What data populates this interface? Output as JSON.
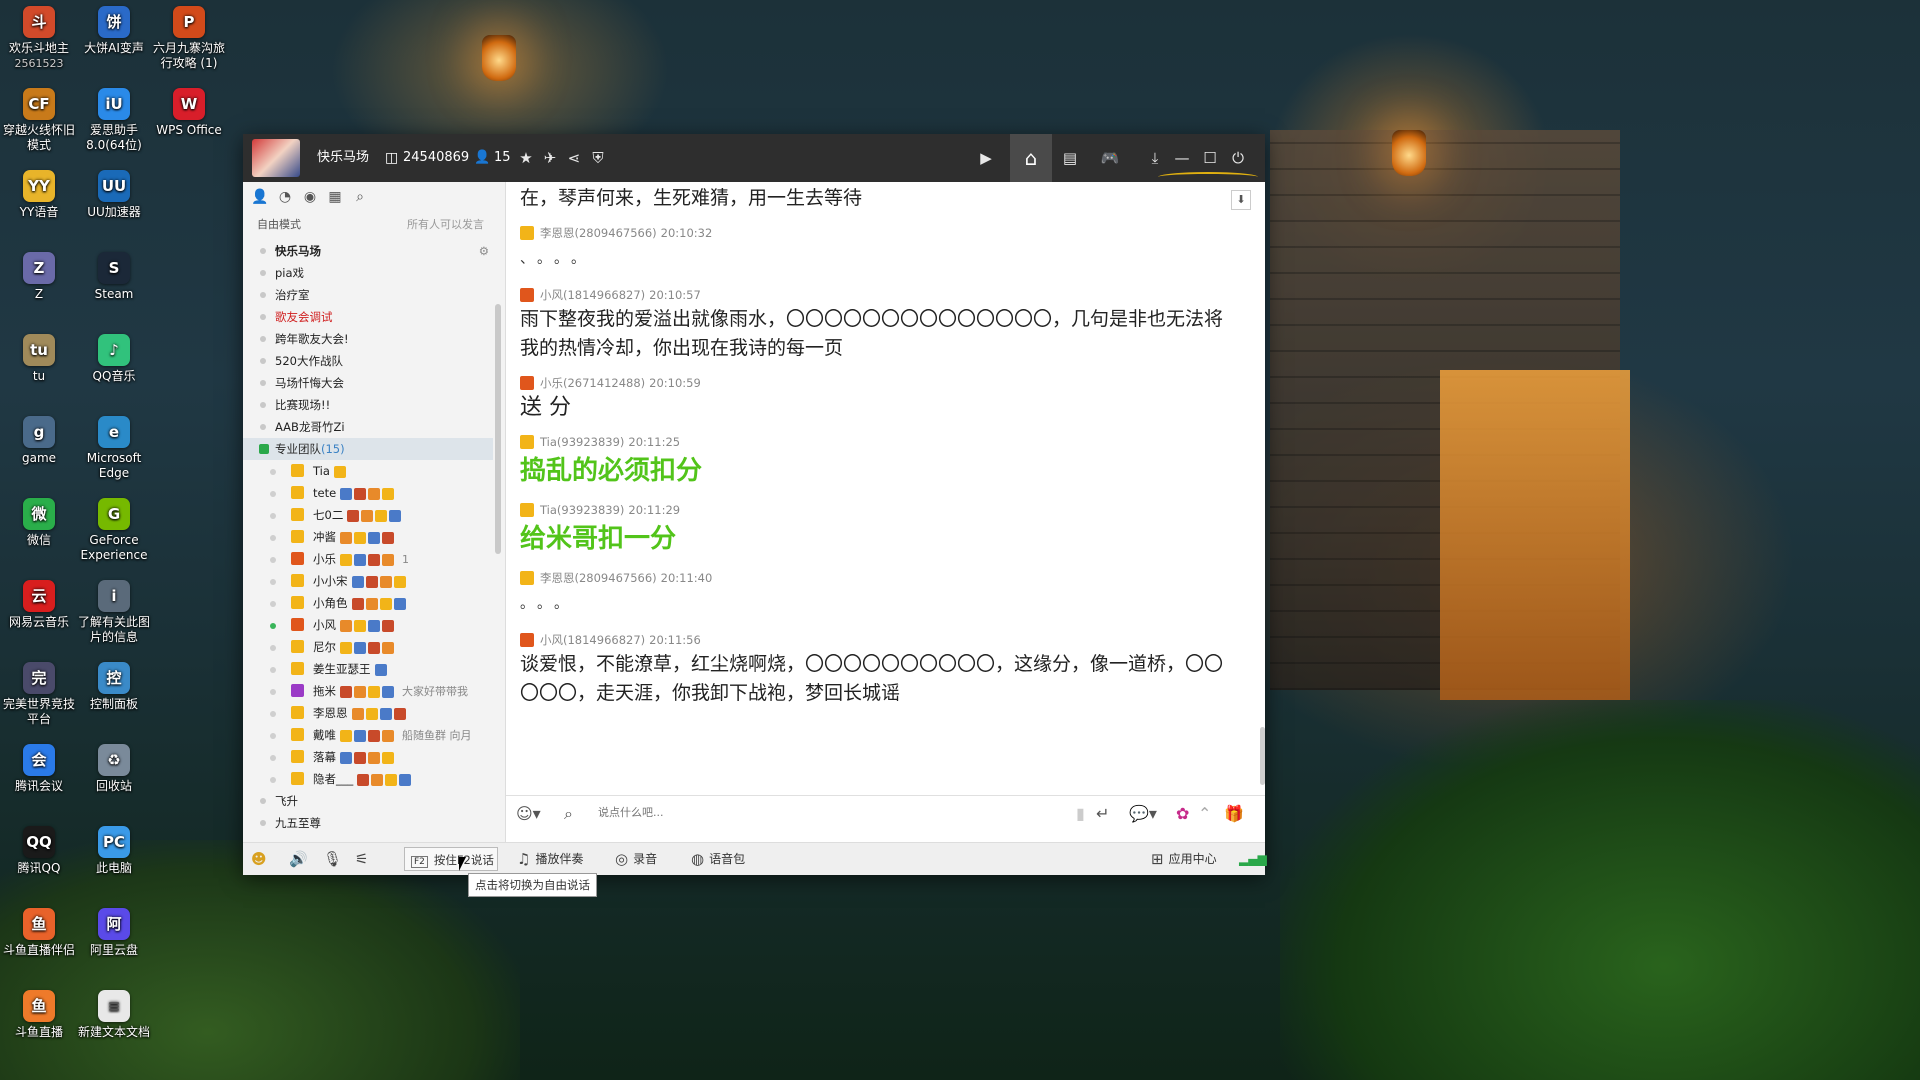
{
  "desktop": {
    "col1": [
      {
        "label": "欢乐斗地主",
        "sub": "2561523",
        "glyph": "斗",
        "color": "#d24a2a"
      },
      {
        "label": "穿越火线怀旧模式",
        "sub": "",
        "glyph": "CF",
        "color": "#c87a1a"
      },
      {
        "label": "YY语音",
        "sub": "",
        "glyph": "YY",
        "color": "#e8b42a"
      },
      {
        "label": "Z",
        "sub": "",
        "glyph": "Z",
        "color": "#6a6aa8"
      },
      {
        "label": "tu",
        "sub": "",
        "glyph": "tu",
        "color": "#a08a5a"
      },
      {
        "label": "game",
        "sub": "",
        "glyph": "g",
        "color": "#4a6a8a"
      },
      {
        "label": "微信",
        "sub": "",
        "glyph": "微",
        "color": "#2aae4a"
      },
      {
        "label": "网易云音乐",
        "sub": "",
        "glyph": "云",
        "color": "#d81e1e"
      },
      {
        "label": "完美世界竞技平台",
        "sub": "",
        "glyph": "完",
        "color": "#4a4a6a"
      },
      {
        "label": "腾讯会议",
        "sub": "",
        "glyph": "会",
        "color": "#2a7ae8"
      },
      {
        "label": "腾讯QQ",
        "sub": "",
        "glyph": "QQ",
        "color": "#1a1a1a"
      },
      {
        "label": "斗鱼直播伴侣",
        "sub": "",
        "glyph": "鱼",
        "color": "#e8622a"
      },
      {
        "label": "斗鱼直播",
        "sub": "",
        "glyph": "鱼",
        "color": "#ee7a2a"
      }
    ],
    "col2": [
      {
        "label": "大饼AI变声",
        "sub": "",
        "glyph": "饼",
        "color": "#2a6ac8"
      },
      {
        "label": "爱思助手8.0(64位)",
        "sub": "",
        "glyph": "iU",
        "color": "#2a8ae8"
      },
      {
        "label": "UU加速器",
        "sub": "",
        "glyph": "UU",
        "color": "#1a6ab8"
      },
      {
        "label": "Steam",
        "sub": "",
        "glyph": "S",
        "color": "#1b2838"
      },
      {
        "label": "QQ音乐",
        "sub": "",
        "glyph": "♪",
        "color": "#31c27c"
      },
      {
        "label": "Microsoft Edge",
        "sub": "",
        "glyph": "e",
        "color": "#2a8ac8"
      },
      {
        "label": "GeForce Experience",
        "sub": "",
        "glyph": "G",
        "color": "#76b900"
      },
      {
        "label": "了解有关此图片的信息",
        "sub": "",
        "glyph": "i",
        "color": "#5a6a7a"
      },
      {
        "label": "控制面板",
        "sub": "",
        "glyph": "控",
        "color": "#3a8ac8"
      },
      {
        "label": "回收站",
        "sub": "",
        "glyph": "♻",
        "color": "#7a8a9a"
      },
      {
        "label": "此电脑",
        "sub": "",
        "glyph": "PC",
        "color": "#3a9ae8"
      },
      {
        "label": "阿里云盘",
        "sub": "",
        "glyph": "阿",
        "color": "#5a4ae8"
      },
      {
        "label": "新建文本文档",
        "sub": "",
        "glyph": "≡",
        "color": "#e8e8e8"
      }
    ],
    "col3": [
      {
        "label": "六月九寨沟旅行攻略 (1)",
        "sub": "",
        "glyph": "P",
        "color": "#d24a1a"
      },
      {
        "label": "WPS Office",
        "sub": "",
        "glyph": "W",
        "color": "#d81e2a"
      }
    ]
  },
  "window": {
    "channel_name": "快乐马场",
    "channel_id": "24540869",
    "online_count": "15",
    "mode_label": "自由模式",
    "mode_hint": "所有人可以发言"
  },
  "tree": {
    "root": "快乐马场",
    "channels": [
      {
        "label": "pia戏",
        "style": ""
      },
      {
        "label": "治疗室",
        "style": ""
      },
      {
        "label": "歌友会调试",
        "style": "red"
      },
      {
        "label": "跨年歌友大会!",
        "style": ""
      },
      {
        "label": "520大作战队",
        "style": ""
      },
      {
        "label": "马场忏悔大会",
        "style": ""
      },
      {
        "label": "比赛现场!!",
        "style": ""
      },
      {
        "label": "AAB龙哥竹Zi",
        "style": ""
      }
    ],
    "group": {
      "label": "专业团队",
      "count": "(15)"
    },
    "members": [
      {
        "name": "Tia",
        "role": "",
        "online": false,
        "note": ""
      },
      {
        "name": "tete",
        "role": "",
        "online": false,
        "note": ""
      },
      {
        "name": "七0二",
        "role": "",
        "online": false,
        "note": ""
      },
      {
        "name": "冲酱",
        "role": "",
        "online": false,
        "note": ""
      },
      {
        "name": "小乐",
        "role": "red",
        "online": false,
        "note": "1"
      },
      {
        "name": "小小宋",
        "role": "",
        "online": false,
        "note": ""
      },
      {
        "name": "小角色",
        "role": "",
        "online": false,
        "note": ""
      },
      {
        "name": "小风",
        "role": "red",
        "online": true,
        "note": ""
      },
      {
        "name": "尼尔",
        "role": "",
        "online": false,
        "note": ""
      },
      {
        "name": "姜生亚瑟王",
        "role": "",
        "online": false,
        "note": ""
      },
      {
        "name": "拖米",
        "role": "purple",
        "online": false,
        "note": "大家好带带我"
      },
      {
        "name": "李恩恩",
        "role": "",
        "online": false,
        "note": ""
      },
      {
        "name": "戴唯",
        "role": "",
        "online": false,
        "note": "船随鱼群 向月"
      },
      {
        "name": "落幕",
        "role": "",
        "online": false,
        "note": ""
      },
      {
        "name": "隐者___",
        "role": "",
        "online": false,
        "note": ""
      }
    ],
    "after": [
      {
        "label": "飞升"
      },
      {
        "label": "九五至尊"
      }
    ]
  },
  "messages": [
    {
      "type": "text",
      "text": "在，琴声何来，生死难猜，用一生去等待",
      "meta": false
    },
    {
      "type": "meta",
      "sender": "李恩恩(2809467566)",
      "time": "20:10:32",
      "icon": ""
    },
    {
      "type": "dots",
      "text": "、。。。"
    },
    {
      "type": "meta",
      "sender": "小风(1814966827)",
      "time": "20:10:57",
      "icon": "red"
    },
    {
      "type": "text",
      "text": "雨下整夜我的爱溢出就像雨水，〇〇〇〇〇〇〇〇〇〇〇〇〇〇，几句是非也无法将我的热情冷却，你出现在我诗的每一页"
    },
    {
      "type": "meta",
      "sender": "小乐(2671412488)",
      "time": "20:10:59",
      "icon": "red"
    },
    {
      "type": "big",
      "text": "送 分"
    },
    {
      "type": "meta",
      "sender": "Tia(93923839)",
      "time": "20:11:25",
      "icon": ""
    },
    {
      "type": "green",
      "text": "捣乱的必须扣分"
    },
    {
      "type": "meta",
      "sender": "Tia(93923839)",
      "time": "20:11:29",
      "icon": ""
    },
    {
      "type": "green",
      "text": "给米哥扣一分"
    },
    {
      "type": "meta",
      "sender": "李恩恩(2809467566)",
      "time": "20:11:40",
      "icon": ""
    },
    {
      "type": "dots",
      "text": "。。。"
    },
    {
      "type": "meta",
      "sender": "小风(1814966827)",
      "time": "20:11:56",
      "icon": "red"
    },
    {
      "type": "text",
      "text": "谈爱恨，不能潦草，红尘烧啊烧，〇〇〇〇〇〇〇〇〇〇，这缘分，像一道桥，〇〇〇〇〇，走天涯，你我卸下战袍，梦回长城谣"
    }
  ],
  "input": {
    "placeholder": "说点什么吧..."
  },
  "bottom": {
    "f2_label": "按住F2说话",
    "music_label": "播放伴奏",
    "record_label": "录音",
    "voicepack_label": "语音包",
    "appcenter_label": "应用中心",
    "tooltip": "点击将切换为自由说话"
  },
  "colors": {
    "green_text": "#52c41a",
    "titlebar": "#2e2e2e",
    "red_channel": "#d02020"
  }
}
